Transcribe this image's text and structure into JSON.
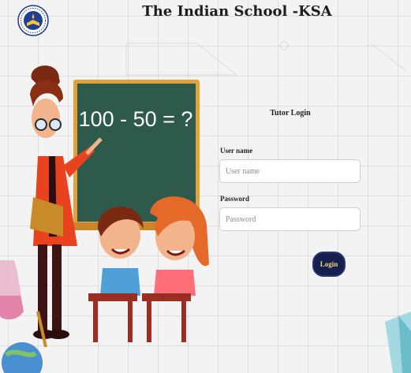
{
  "header": {
    "title": "The Indian School -KSA",
    "logo_icon": "school-emblem-icon"
  },
  "illustration": {
    "chalkboard_text": "100 - 50 = ?"
  },
  "login_form": {
    "heading": "Tutor Login",
    "username_label": "User name",
    "username_placeholder": "User name",
    "username_value": "",
    "password_label": "Password",
    "password_placeholder": "Password",
    "password_value": "",
    "login_button_label": "Login"
  },
  "colors": {
    "background": "#f3f3f3",
    "chalkboard": "#2e5a4c",
    "chalkboard_frame": "#e0a33b",
    "login_button": "#141f4f",
    "login_button_text": "#f2d178"
  }
}
